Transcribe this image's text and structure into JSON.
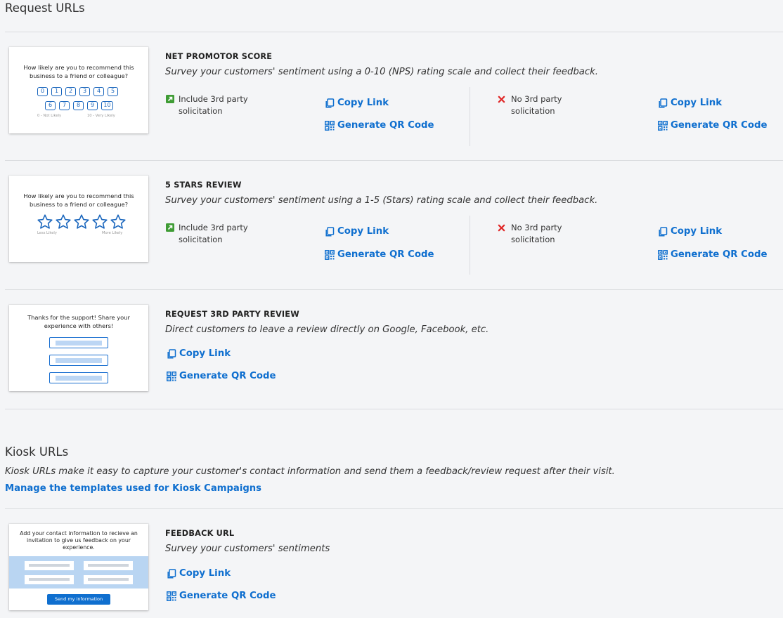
{
  "request_urls": {
    "title": "Request URLs",
    "items": [
      {
        "name": "NET PROMOTOR SCORE",
        "description": "Survey your customers' sentiment using a 0-10 (NPS) rating scale and collect their feedback.",
        "preview": {
          "question": "How likely are you to recommend this business to a friend or colleague?",
          "scale_row1": [
            "0",
            "1",
            "2",
            "3",
            "4",
            "5"
          ],
          "scale_row2": [
            "6",
            "7",
            "8",
            "9",
            "10"
          ],
          "low_label": "0 - Not Likely",
          "high_label": "10 - Very Likely"
        },
        "options": [
          {
            "label": "Include 3rd party solicitation",
            "icon": "external-link-icon",
            "copy_label": "Copy Link",
            "qr_label": "Generate QR Code"
          },
          {
            "label": "No 3rd party solicitation",
            "icon": "x-icon",
            "copy_label": "Copy Link",
            "qr_label": "Generate QR Code"
          }
        ]
      },
      {
        "name": "5 STARS REVIEW",
        "description": "Survey your customers' sentiment using a 1-5 (Stars) rating scale and collect their feedback.",
        "preview": {
          "question": "How likely are you to recommend this business to a friend or colleague?",
          "low_label": "Less Likely",
          "high_label": "More Likely"
        },
        "options": [
          {
            "label": "Include 3rd party solicitation",
            "icon": "external-link-icon",
            "copy_label": "Copy Link",
            "qr_label": "Generate QR Code"
          },
          {
            "label": "No 3rd party solicitation",
            "icon": "x-icon",
            "copy_label": "Copy Link",
            "qr_label": "Generate QR Code"
          }
        ]
      },
      {
        "name": "REQUEST 3RD PARTY REVIEW",
        "description": "Direct customers to leave a review directly on Google, Facebook, etc.",
        "preview": {
          "question": "Thanks for the support! Share your experience with others!"
        },
        "copy_label": "Copy Link",
        "qr_label": "Generate QR Code"
      }
    ]
  },
  "kiosk_urls": {
    "title": "Kiosk URLs",
    "description": "Kiosk URLs make it easy to capture your customer's contact information and send them a feedback/review request after their visit.",
    "manage_link": "Manage the templates used for Kiosk Campaigns",
    "items": [
      {
        "name": "FEEDBACK URL",
        "description": "Survey your customers' sentiments",
        "preview": {
          "question": "Add your contact information to recieve an invitation to give us feedback on your experience.",
          "button": "Send my information"
        },
        "copy_label": "Copy Link",
        "qr_label": "Generate QR Code"
      }
    ]
  },
  "colors": {
    "link": "#0f6fcf",
    "include_icon": "#3f9c35",
    "exclude_icon": "#e02828",
    "background": "#f4f5f7"
  }
}
